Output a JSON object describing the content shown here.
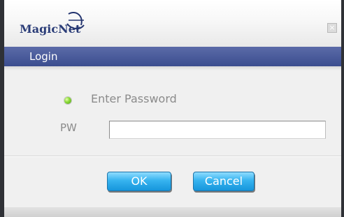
{
  "titlebar": {
    "logo_text": "MagicNet",
    "close_icon": "close-icon"
  },
  "header": {
    "title": "Login"
  },
  "form": {
    "status_text": "Enter Password",
    "status_icon": "green-status-icon",
    "pw_label": "PW",
    "pw_value": ""
  },
  "buttons": {
    "ok_label": "OK",
    "cancel_label": "Cancel"
  },
  "colors": {
    "header_bar": "#3b4d8f",
    "button": "#2fb0ec",
    "status_dot": "#7ccf34"
  }
}
